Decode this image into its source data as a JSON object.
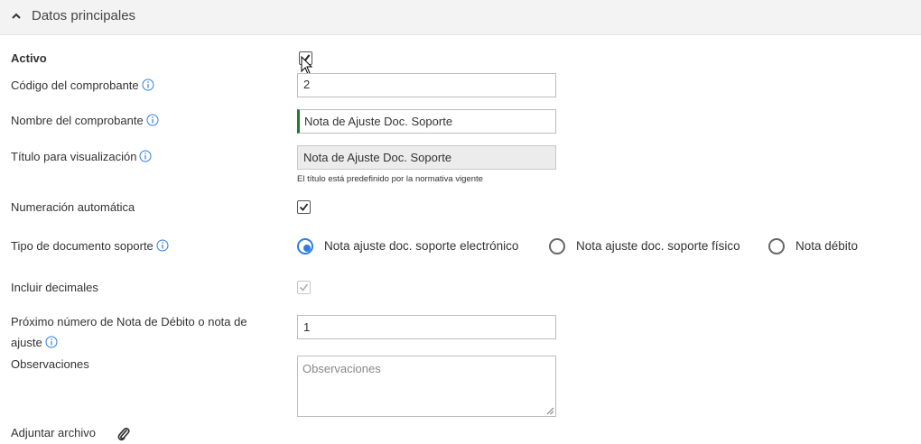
{
  "section": {
    "title": "Datos principales"
  },
  "fields": {
    "activo": {
      "label": "Activo",
      "checked": true
    },
    "codigo": {
      "label": "Código del comprobante",
      "value": "2"
    },
    "nombre": {
      "label": "Nombre del comprobante",
      "value": "Nota de Ajuste Doc. Soporte"
    },
    "titulo": {
      "label": "Título para visualización",
      "value": "Nota de Ajuste Doc. Soporte",
      "hint": "El título está predefinido por la normativa vigente"
    },
    "numeracion": {
      "label": "Numeración automática",
      "checked": true
    },
    "tipo_doc": {
      "label": "Tipo de documento soporte",
      "options": [
        "Nota ajuste doc. soporte electrónico",
        "Nota ajuste doc. soporte físico",
        "Nota débito"
      ],
      "selected": "Nota ajuste doc. soporte electrónico"
    },
    "decimales": {
      "label": "Incluir decimales",
      "checked": true,
      "disabled": true
    },
    "proximo": {
      "label_line1": "Próximo número de Nota de Débito o nota de",
      "label_line2": "ajuste",
      "value": "1"
    },
    "observaciones": {
      "label": "Observaciones",
      "placeholder": "Observaciones"
    },
    "adjuntar": {
      "label": "Adjuntar archivo"
    }
  },
  "icons": {
    "collapse": "chevron-up-icon",
    "info": "info-icon",
    "attach": "paperclip-icon",
    "check": "checkmark-icon"
  },
  "colors": {
    "accent": "#2f7de1",
    "focus_bar": "#1e7d32",
    "readonly_bg": "#ececec"
  }
}
